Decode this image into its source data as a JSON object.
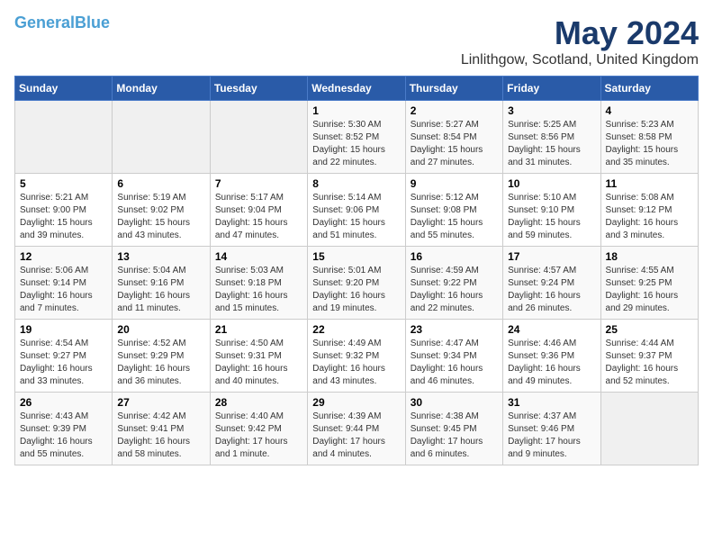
{
  "header": {
    "logo_line1": "General",
    "logo_accent": "Blue",
    "month_title": "May 2024",
    "location": "Linlithgow, Scotland, United Kingdom"
  },
  "days_of_week": [
    "Sunday",
    "Monday",
    "Tuesday",
    "Wednesday",
    "Thursday",
    "Friday",
    "Saturday"
  ],
  "weeks": [
    [
      {
        "day": "",
        "info": ""
      },
      {
        "day": "",
        "info": ""
      },
      {
        "day": "",
        "info": ""
      },
      {
        "day": "1",
        "info": "Sunrise: 5:30 AM\nSunset: 8:52 PM\nDaylight: 15 hours\nand 22 minutes."
      },
      {
        "day": "2",
        "info": "Sunrise: 5:27 AM\nSunset: 8:54 PM\nDaylight: 15 hours\nand 27 minutes."
      },
      {
        "day": "3",
        "info": "Sunrise: 5:25 AM\nSunset: 8:56 PM\nDaylight: 15 hours\nand 31 minutes."
      },
      {
        "day": "4",
        "info": "Sunrise: 5:23 AM\nSunset: 8:58 PM\nDaylight: 15 hours\nand 35 minutes."
      }
    ],
    [
      {
        "day": "5",
        "info": "Sunrise: 5:21 AM\nSunset: 9:00 PM\nDaylight: 15 hours\nand 39 minutes."
      },
      {
        "day": "6",
        "info": "Sunrise: 5:19 AM\nSunset: 9:02 PM\nDaylight: 15 hours\nand 43 minutes."
      },
      {
        "day": "7",
        "info": "Sunrise: 5:17 AM\nSunset: 9:04 PM\nDaylight: 15 hours\nand 47 minutes."
      },
      {
        "day": "8",
        "info": "Sunrise: 5:14 AM\nSunset: 9:06 PM\nDaylight: 15 hours\nand 51 minutes."
      },
      {
        "day": "9",
        "info": "Sunrise: 5:12 AM\nSunset: 9:08 PM\nDaylight: 15 hours\nand 55 minutes."
      },
      {
        "day": "10",
        "info": "Sunrise: 5:10 AM\nSunset: 9:10 PM\nDaylight: 15 hours\nand 59 minutes."
      },
      {
        "day": "11",
        "info": "Sunrise: 5:08 AM\nSunset: 9:12 PM\nDaylight: 16 hours\nand 3 minutes."
      }
    ],
    [
      {
        "day": "12",
        "info": "Sunrise: 5:06 AM\nSunset: 9:14 PM\nDaylight: 16 hours\nand 7 minutes."
      },
      {
        "day": "13",
        "info": "Sunrise: 5:04 AM\nSunset: 9:16 PM\nDaylight: 16 hours\nand 11 minutes."
      },
      {
        "day": "14",
        "info": "Sunrise: 5:03 AM\nSunset: 9:18 PM\nDaylight: 16 hours\nand 15 minutes."
      },
      {
        "day": "15",
        "info": "Sunrise: 5:01 AM\nSunset: 9:20 PM\nDaylight: 16 hours\nand 19 minutes."
      },
      {
        "day": "16",
        "info": "Sunrise: 4:59 AM\nSunset: 9:22 PM\nDaylight: 16 hours\nand 22 minutes."
      },
      {
        "day": "17",
        "info": "Sunrise: 4:57 AM\nSunset: 9:24 PM\nDaylight: 16 hours\nand 26 minutes."
      },
      {
        "day": "18",
        "info": "Sunrise: 4:55 AM\nSunset: 9:25 PM\nDaylight: 16 hours\nand 29 minutes."
      }
    ],
    [
      {
        "day": "19",
        "info": "Sunrise: 4:54 AM\nSunset: 9:27 PM\nDaylight: 16 hours\nand 33 minutes."
      },
      {
        "day": "20",
        "info": "Sunrise: 4:52 AM\nSunset: 9:29 PM\nDaylight: 16 hours\nand 36 minutes."
      },
      {
        "day": "21",
        "info": "Sunrise: 4:50 AM\nSunset: 9:31 PM\nDaylight: 16 hours\nand 40 minutes."
      },
      {
        "day": "22",
        "info": "Sunrise: 4:49 AM\nSunset: 9:32 PM\nDaylight: 16 hours\nand 43 minutes."
      },
      {
        "day": "23",
        "info": "Sunrise: 4:47 AM\nSunset: 9:34 PM\nDaylight: 16 hours\nand 46 minutes."
      },
      {
        "day": "24",
        "info": "Sunrise: 4:46 AM\nSunset: 9:36 PM\nDaylight: 16 hours\nand 49 minutes."
      },
      {
        "day": "25",
        "info": "Sunrise: 4:44 AM\nSunset: 9:37 PM\nDaylight: 16 hours\nand 52 minutes."
      }
    ],
    [
      {
        "day": "26",
        "info": "Sunrise: 4:43 AM\nSunset: 9:39 PM\nDaylight: 16 hours\nand 55 minutes."
      },
      {
        "day": "27",
        "info": "Sunrise: 4:42 AM\nSunset: 9:41 PM\nDaylight: 16 hours\nand 58 minutes."
      },
      {
        "day": "28",
        "info": "Sunrise: 4:40 AM\nSunset: 9:42 PM\nDaylight: 17 hours\nand 1 minute."
      },
      {
        "day": "29",
        "info": "Sunrise: 4:39 AM\nSunset: 9:44 PM\nDaylight: 17 hours\nand 4 minutes."
      },
      {
        "day": "30",
        "info": "Sunrise: 4:38 AM\nSunset: 9:45 PM\nDaylight: 17 hours\nand 6 minutes."
      },
      {
        "day": "31",
        "info": "Sunrise: 4:37 AM\nSunset: 9:46 PM\nDaylight: 17 hours\nand 9 minutes."
      },
      {
        "day": "",
        "info": ""
      }
    ]
  ]
}
